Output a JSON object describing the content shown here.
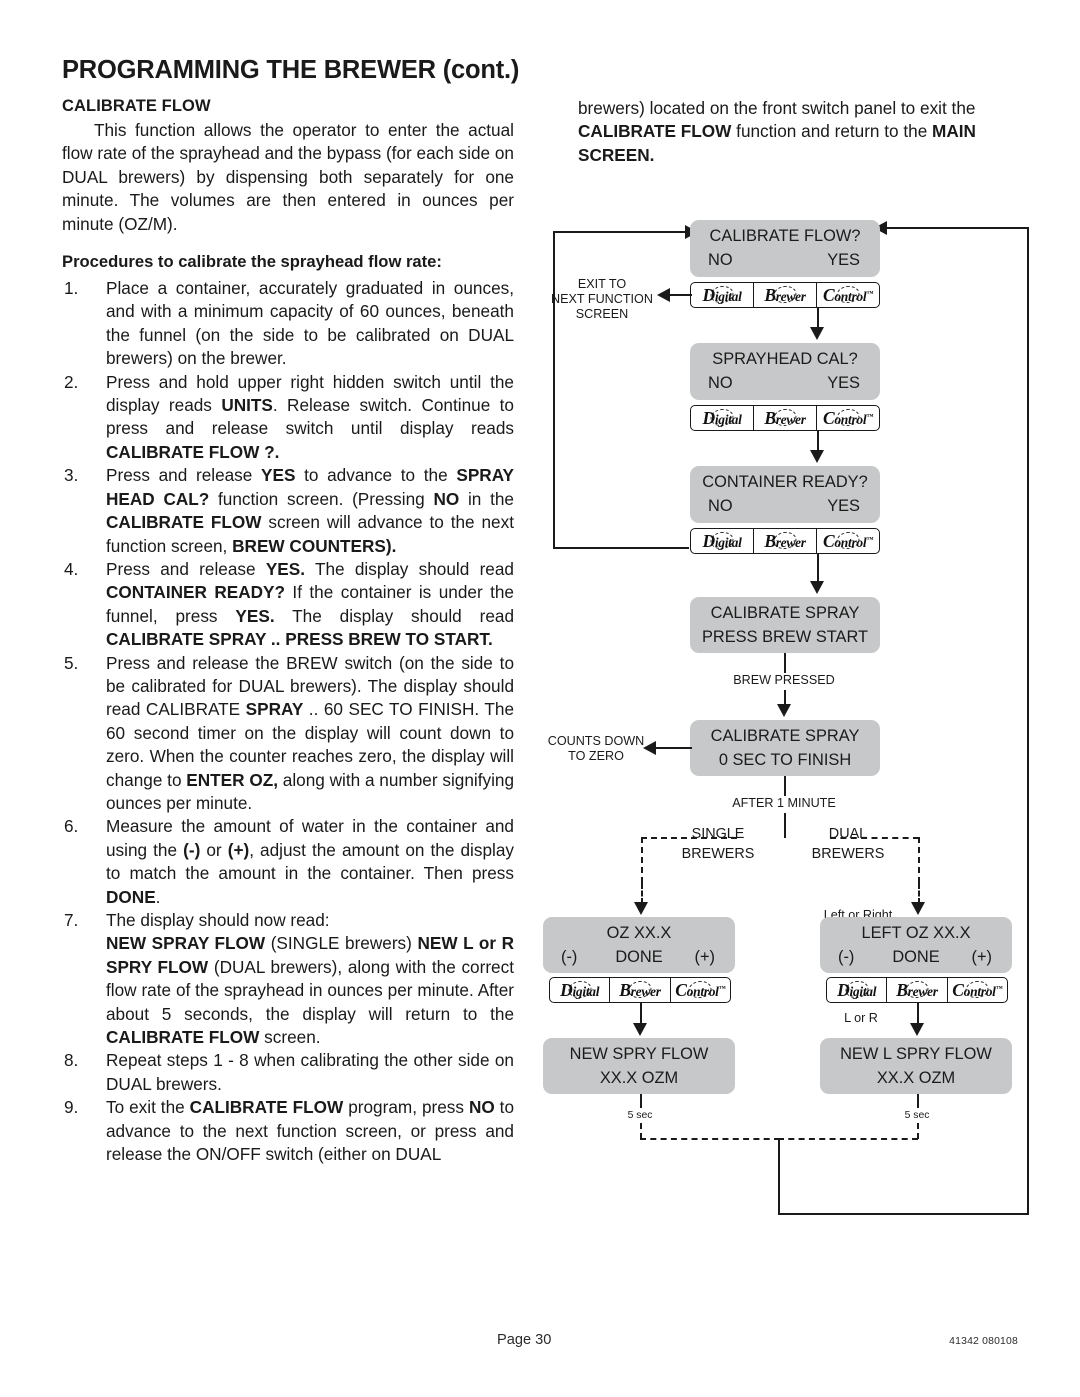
{
  "header": {
    "title": "PROGRAMMING THE BREWER (cont.)"
  },
  "left": {
    "section_heading": "CALIBRATE FLOW",
    "intro": "This function allows the operator to enter the actual flow rate of the sprayhead and the bypass (for each side on DUAL brewers) by dispensing both separately for one minute. The volumes are then entered in ounces per minute (OZ/M).",
    "procedures_heading": "Procedures to calibrate the sprayhead flow rate:",
    "steps": [
      {
        "num": "1.",
        "text": "Place a container, accurately graduated in ounces, and with a minimum capacity of 60 ounces, beneath the funnel (on the side to be calibrated on DUAL brewers) on the brewer."
      },
      {
        "num": "2.",
        "text": "Press and hold upper right hidden switch until the display reads UNITS. Release switch. Continue to press and release switch until display reads CALIBRATE FLOW ?."
      },
      {
        "num": "3.",
        "text": "Press and release YES to advance to the SPRAY HEAD CAL? function screen. (Pressing NO in the CALIBRATE FLOW screen will advance to the next function screen, BREW COUNTERS)."
      },
      {
        "num": "4.",
        "text": "Press and release YES. The display should read CONTAINER READY? If the container is under the funnel, press YES. The display should read CALIBRATE SPRAY .. PRESS BREW TO START."
      },
      {
        "num": "5.",
        "text": "Press and release the BREW switch (on the side to be calibrated for DUAL brewers). The display should read CALIBRATE SPRAY .. 60 SEC TO FINISH. The 60 second timer on the display will count down to zero. When the counter reaches zero, the display will change to ENTER OZ, along with a number signifying ounces per minute."
      },
      {
        "num": "6.",
        "text": "Measure the amount of water in the container and using the (-) or (+), adjust the amount on the display to match the amount in the container. Then press DONE."
      },
      {
        "num": "7.",
        "text": "The display should now read: NEW SPRAY FLOW (SINGLE brewers) NEW L or R SPRY FLOW (DUAL brewers), along with the correct flow rate of the sprayhead in ounces per minute. After about 5 seconds, the display will return to the CALIBRATE FLOW screen."
      },
      {
        "num": "8.",
        "text": "Repeat steps 1 - 8 when calibrating the other side on DUAL brewers."
      },
      {
        "num": "9.",
        "text": "To exit the CALIBRATE FLOW program, press NO to advance to the next function screen, or press and release the ON/OFF switch (either on DUAL"
      }
    ]
  },
  "right": {
    "continuation": "brewers) located on the front switch panel to exit the CALIBRATE FLOW function and return to the MAIN SCREEN."
  },
  "flowchart": {
    "control_panel": {
      "cell1": "Digital",
      "cell2": "Brewer",
      "cell3": "Control",
      "tm": "™"
    },
    "screens": {
      "calibrate_flow": {
        "line1": "CALIBRATE FLOW?",
        "no": "NO",
        "yes": "YES"
      },
      "sprayhead_cal": {
        "line1": "SPRAYHEAD CAL?",
        "no": "NO",
        "yes": "YES"
      },
      "container_ready": {
        "line1": "CONTAINER READY?",
        "no": "NO",
        "yes": "YES"
      },
      "calibrate_spray_start": {
        "line1": "CALIBRATE SPRAY",
        "line2": "PRESS  BREW  START"
      },
      "calibrate_spray_finish": {
        "line1": "CALIBRATE SPRAY",
        "line2": "0  SEC  TO  FINISH"
      },
      "single_oz": {
        "line1": "OZ XX.X",
        "minus": "(-)",
        "done": "DONE",
        "plus": "(+)"
      },
      "dual_oz": {
        "line1": "LEFT OZ XX.X",
        "minus": "(-)",
        "done": "DONE",
        "plus": "(+)"
      },
      "single_new_flow": {
        "line1": "NEW SPRY FLOW",
        "line2": "XX.X  OZM"
      },
      "dual_new_flow": {
        "line1": "NEW L SPRY FLOW",
        "line2": "XX.X  OZM"
      }
    },
    "labels": {
      "exit_to_next": "EXIT TO\nNEXT FUNCTION\nSCREEN",
      "brew_pressed": "BREW PRESSED",
      "counts_down": "COUNTS DOWN\nTO ZERO",
      "after_one_minute": "AFTER 1 MINUTE",
      "single": "SINGLE",
      "single_brewers": "BREWERS",
      "dual": "DUAL",
      "dual_brewers": "BREWERS",
      "left_or_right": "Left or Right",
      "l_or_r": "L or R",
      "five_sec_left": "5 sec",
      "five_sec_right": "5 sec"
    }
  },
  "footer": {
    "page": "Page 30",
    "code": "41342 080108"
  }
}
